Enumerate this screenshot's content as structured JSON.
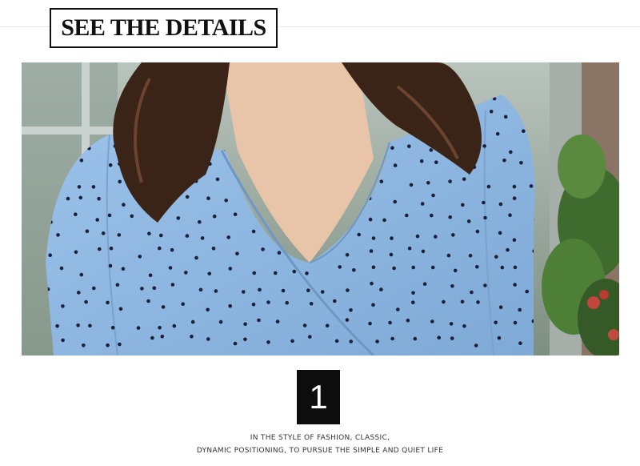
{
  "header": {
    "title": "SEE THE DETAILS"
  },
  "detail": {
    "number": "1",
    "caption_line1": "IN THE STYLE OF FASHION, CLASSIC,",
    "caption_line2": "DYNAMIC POSITIONING, TO PURSUE THE SIMPLE AND QUIET LIFE"
  },
  "photo": {
    "subject": "blue polka dot wrap top",
    "colors": {
      "fabric": "#8fb8e2",
      "dots": "#1a1f3a",
      "hair": "#3a2418",
      "skin": "#e8c4a8",
      "foliage": "#3f6b2e"
    }
  }
}
